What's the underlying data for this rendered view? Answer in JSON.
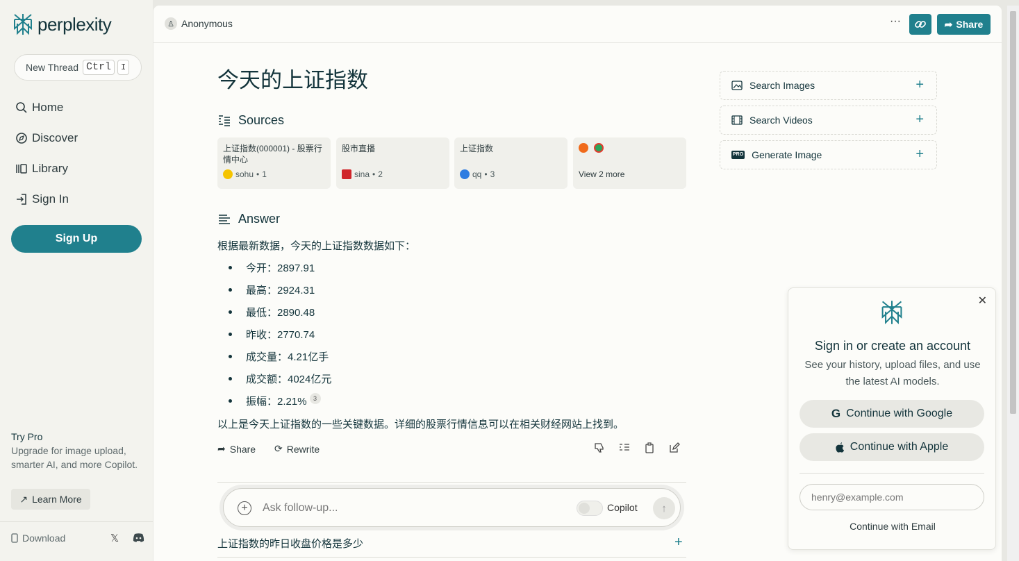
{
  "app": {
    "name": "perplexity"
  },
  "sidebar": {
    "new_thread": "New Thread",
    "kbd_ctrl": "Ctrl",
    "kbd_i": "I",
    "nav": [
      {
        "label": "Home",
        "icon": "search-icon"
      },
      {
        "label": "Discover",
        "icon": "compass-icon"
      },
      {
        "label": "Library",
        "icon": "library-icon"
      },
      {
        "label": "Sign In",
        "icon": "sign-in-icon"
      }
    ],
    "signup": "Sign Up",
    "try_pro_title": "Try Pro",
    "try_pro_text": "Upgrade for image upload, smarter AI, and more Copilot.",
    "learn_more": "Learn More",
    "download": "Download"
  },
  "topbar": {
    "user": "Anonymous",
    "share": "Share"
  },
  "thread": {
    "title": "今天的上证指数",
    "sources_heading": "Sources",
    "sources": [
      {
        "title": "上证指数(000001) - 股票行情中心",
        "site": "sohu",
        "index": "1",
        "color": "#f5c400"
      },
      {
        "title": "股市直播",
        "site": "sina",
        "index": "2",
        "color": "#d0262b"
      },
      {
        "title": "上证指数",
        "site": "qq",
        "index": "3",
        "color": "#2f7de1"
      }
    ],
    "view_more": "View 2 more",
    "answer_heading": "Answer",
    "answer_intro": "根据最新数据，今天的上证指数数据如下：",
    "bullets": [
      "今开：2897.91",
      "最高：2924.31",
      "最低：2890.48",
      "昨收：2770.74",
      "成交量：4.21亿手",
      "成交额：4024亿元",
      "振幅：2.21%"
    ],
    "citation": "3",
    "answer_outro": "以上是今天上证指数的一些关键数据。详细的股票行情信息可以在相关财经网站上找到。",
    "share": "Share",
    "rewrite": "Rewrite",
    "followup_placeholder": "Ask follow-up...",
    "copilot": "Copilot",
    "related": "上证指数的昨日收盘价格是多少"
  },
  "side_actions": [
    {
      "label": "Search Images",
      "icon": "image-icon"
    },
    {
      "label": "Search Videos",
      "icon": "film-icon"
    },
    {
      "label": "Generate Image",
      "icon": "pro-icon"
    }
  ],
  "popup": {
    "title": "Sign in or create an account",
    "subtitle": "See your history, upload files, and use the latest AI models.",
    "google": "Continue with Google",
    "apple": "Continue with Apple",
    "email_placeholder": "henry@example.com",
    "continue_email": "Continue with Email"
  },
  "colors": {
    "accent": "#20808d",
    "background": "#fcfcf9",
    "sidebar": "#f3f3ee"
  }
}
